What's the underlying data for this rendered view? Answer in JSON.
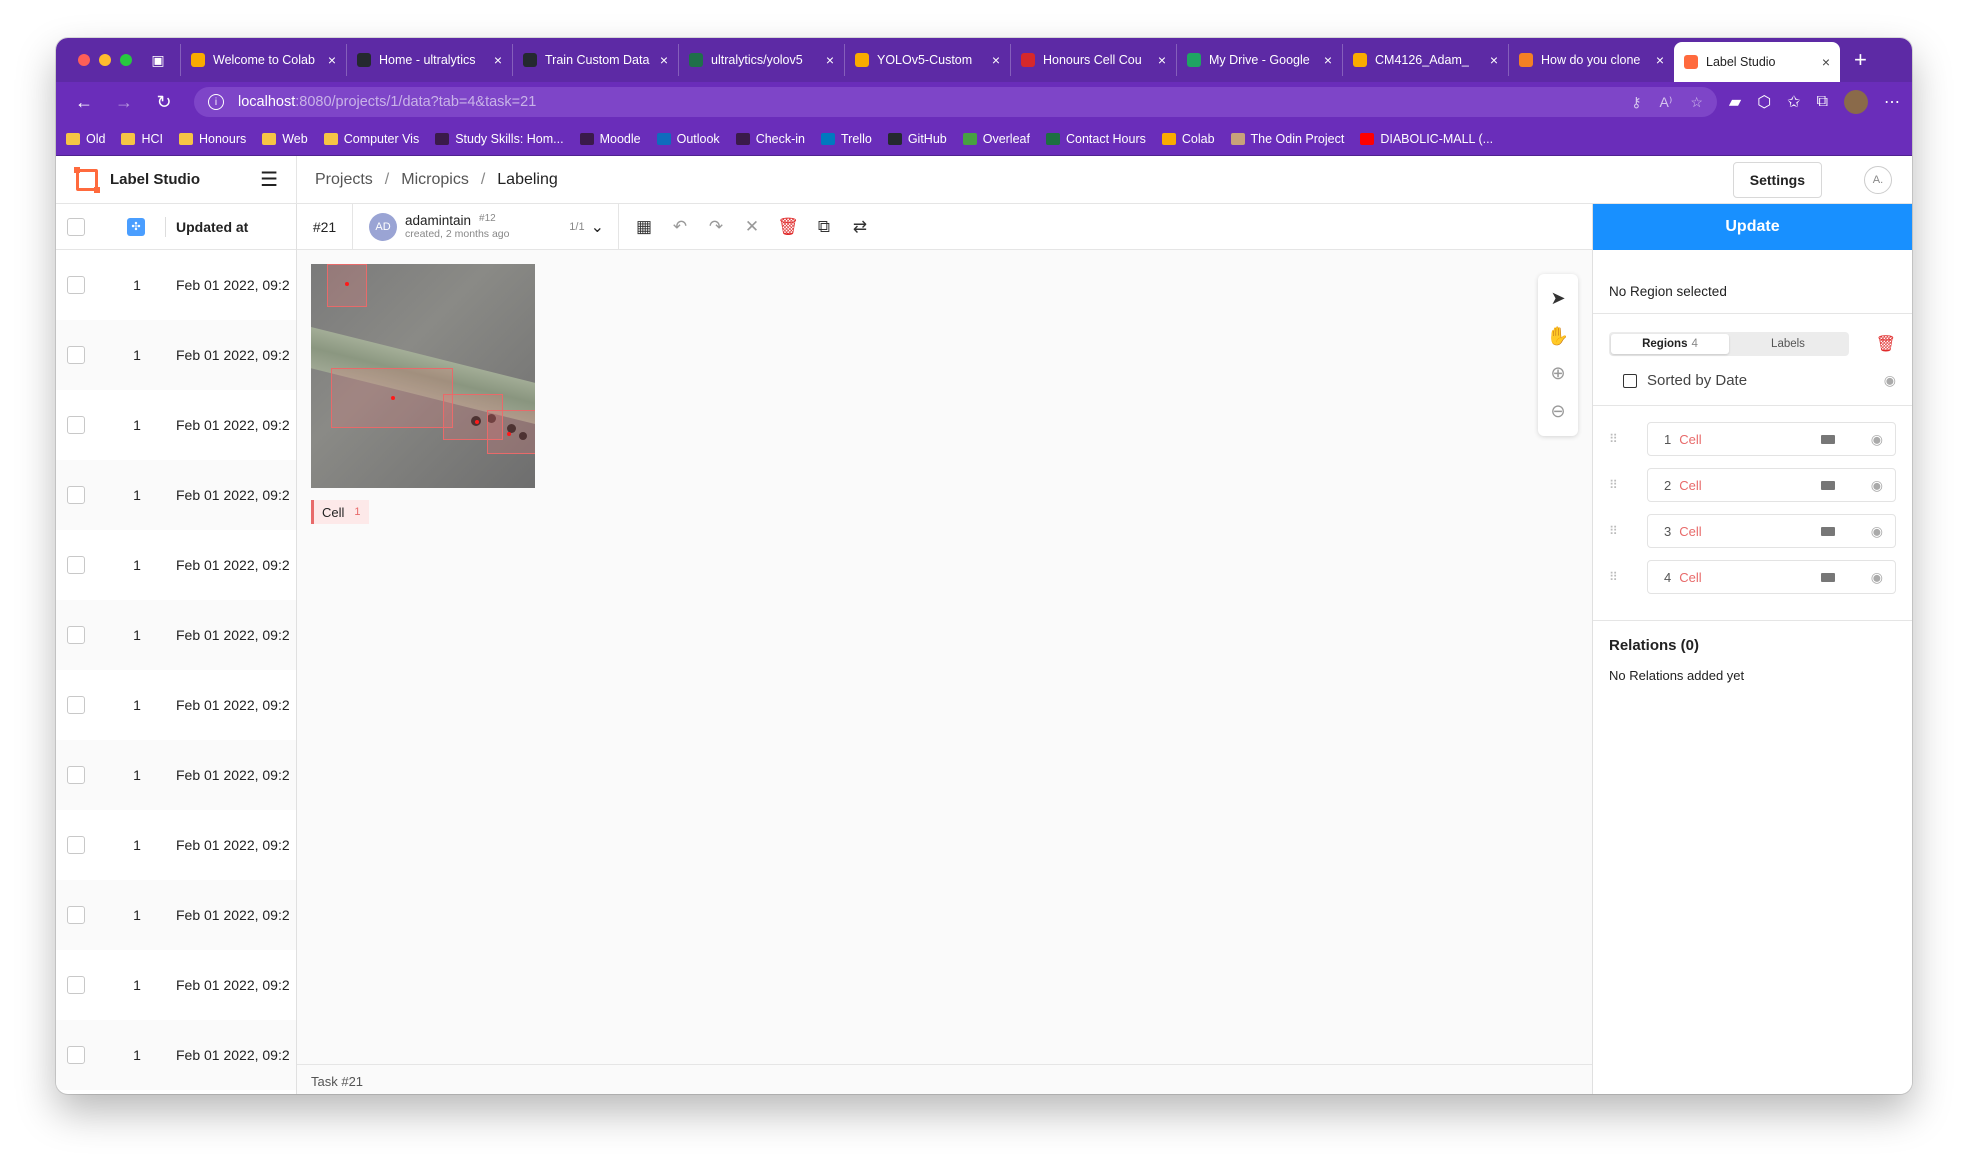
{
  "browser": {
    "tabs": [
      {
        "title": "Welcome to Colab",
        "color": "#f9ab00"
      },
      {
        "title": "Home - ultralytics",
        "color": "#24292f"
      },
      {
        "title": "Train Custom Data",
        "color": "#24292f"
      },
      {
        "title": "ultralytics/yolov5",
        "color": "#1f6f4a"
      },
      {
        "title": "YOLOv5-Custom",
        "color": "#f9ab00"
      },
      {
        "title": "Honours Cell Cou",
        "color": "#d6282b"
      },
      {
        "title": "My Drive - Google",
        "color": "#1fa463"
      },
      {
        "title": "CM4126_Adam_",
        "color": "#f9ab00"
      },
      {
        "title": "How do you clone",
        "color": "#f48024"
      },
      {
        "title": "Label Studio",
        "color": "#ff6a3d",
        "active": true
      }
    ],
    "url_host": "localhost",
    "url_rest": ":8080/projects/1/data?tab=4&task=21",
    "bookmarks": [
      {
        "label": "Old",
        "icon": "folder-icon",
        "color": "#f6c445"
      },
      {
        "label": "HCI",
        "icon": "folder-icon",
        "color": "#f6c445"
      },
      {
        "label": "Honours",
        "icon": "folder-icon",
        "color": "#f6c445"
      },
      {
        "label": "Web",
        "icon": "folder-icon",
        "color": "#f6c445"
      },
      {
        "label": "Computer Vis",
        "icon": "folder-icon",
        "color": "#f6c445"
      },
      {
        "label": "Study Skills: Hom...",
        "icon": "moodle-icon",
        "color": "#3a1a4a"
      },
      {
        "label": "Moodle",
        "icon": "moodle-icon",
        "color": "#3a1a4a"
      },
      {
        "label": "Outlook",
        "icon": "outlook-icon",
        "color": "#0f6cbd"
      },
      {
        "label": "Check-in",
        "icon": "checkin-icon",
        "color": "#3a1a4a"
      },
      {
        "label": "Trello",
        "icon": "trello-icon",
        "color": "#0079bf"
      },
      {
        "label": "GitHub",
        "icon": "github-icon",
        "color": "#24292f"
      },
      {
        "label": "Overleaf",
        "icon": "overleaf-icon",
        "color": "#47a141"
      },
      {
        "label": "Contact Hours",
        "icon": "excel-icon",
        "color": "#1d6f42"
      },
      {
        "label": "Colab",
        "icon": "colab-icon",
        "color": "#f9ab00"
      },
      {
        "label": "The Odin Project",
        "icon": "odin-icon",
        "color": "#c8a27a"
      },
      {
        "label": "DIABOLIC-MALL (...",
        "icon": "youtube-icon",
        "color": "#ff0000"
      }
    ]
  },
  "app": {
    "brand": "Label Studio",
    "breadcrumbs": [
      "Projects",
      "Micropics",
      "Labeling"
    ],
    "settings_label": "Settings",
    "user_initials": "A."
  },
  "table": {
    "header": "Updated at",
    "rows": [
      {
        "count": "1",
        "date": "Feb 01 2022, 09:2"
      },
      {
        "count": "1",
        "date": "Feb 01 2022, 09:2"
      },
      {
        "count": "1",
        "date": "Feb 01 2022, 09:2"
      },
      {
        "count": "1",
        "date": "Feb 01 2022, 09:2"
      },
      {
        "count": "1",
        "date": "Feb 01 2022, 09:2"
      },
      {
        "count": "1",
        "date": "Feb 01 2022, 09:2"
      },
      {
        "count": "1",
        "date": "Feb 01 2022, 09:2"
      },
      {
        "count": "1",
        "date": "Feb 01 2022, 09:2"
      },
      {
        "count": "1",
        "date": "Feb 01 2022, 09:2"
      },
      {
        "count": "1",
        "date": "Feb 01 2022, 09:2"
      },
      {
        "count": "1",
        "date": "Feb 01 2022, 09:2"
      },
      {
        "count": "1",
        "date": "Feb 01 2022, 09:2"
      }
    ]
  },
  "labeling": {
    "task_id": "#21",
    "annotator_initials": "AD",
    "annotator": "adamintain",
    "annotation_id": "#12",
    "created": "created, 2 months ago",
    "annotation_count": "1/1",
    "label_chip": {
      "name": "Cell",
      "count": "1",
      "color": "#e86a6a"
    },
    "footer": "Task #21"
  },
  "sidebar": {
    "update_label": "Update",
    "no_region": "No Region selected",
    "tab_regions": "Regions",
    "regions_count": "4",
    "tab_labels": "Labels",
    "sort_label": "Sorted by Date",
    "regions": [
      {
        "index": "1",
        "label": "Cell"
      },
      {
        "index": "2",
        "label": "Cell"
      },
      {
        "index": "3",
        "label": "Cell"
      },
      {
        "index": "4",
        "label": "Cell"
      }
    ],
    "relations_title": "Relations (0)",
    "relations_empty": "No Relations added yet"
  }
}
